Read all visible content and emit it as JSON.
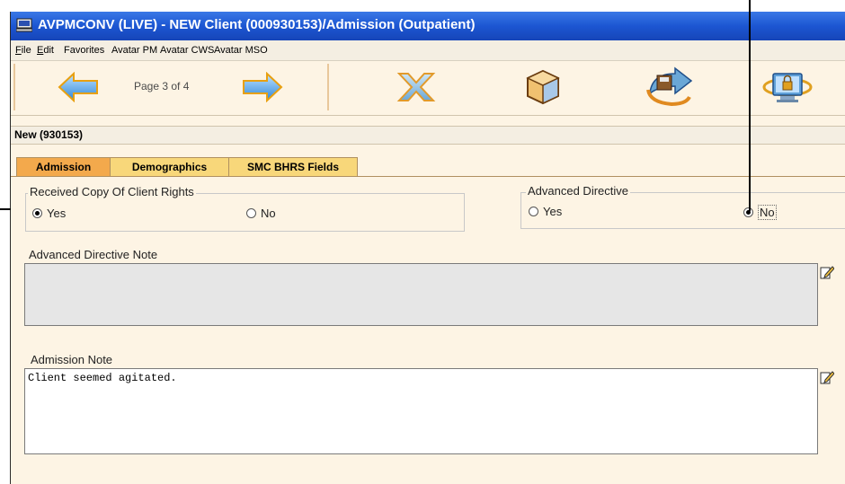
{
  "window": {
    "title": "AVPMCONV (LIVE) - NEW Client (000930153)/Admission (Outpatient)"
  },
  "menu": {
    "items": [
      {
        "mnemonic": "F",
        "rest": "ile"
      },
      {
        "mnemonic": "E",
        "rest": "dit"
      },
      {
        "mnemonic": "",
        "rest": "Favorites"
      },
      {
        "mnemonic": "",
        "rest": "Avatar PM"
      },
      {
        "mnemonic": "",
        "rest": "Avatar CWS"
      },
      {
        "mnemonic": "",
        "rest": "Avatar MSO"
      }
    ]
  },
  "toolbar": {
    "page_label": "Page 3 of 4",
    "icons": [
      "back-arrow-icon",
      "forward-arrow-icon",
      "discard-x-icon",
      "box-icon",
      "submit-disk-icon",
      "secure-monitor-icon"
    ]
  },
  "status": {
    "record": "New (930153)"
  },
  "tabs": [
    {
      "label": "Admission",
      "active": true
    },
    {
      "label": "Demographics",
      "active": false
    },
    {
      "label": "SMC BHRS Fields",
      "active": false
    }
  ],
  "form": {
    "client_rights": {
      "label": "Received Copy Of Client Rights",
      "options": [
        "Yes",
        "No"
      ],
      "selected": "Yes"
    },
    "advanced_directive": {
      "label": "Advanced Directive",
      "options": [
        "Yes",
        "No"
      ],
      "selected": "No"
    },
    "advanced_directive_note": {
      "label": "Advanced Directive Note",
      "value": ""
    },
    "admission_note": {
      "label": "Admission Note",
      "value": "Client seemed agitated."
    }
  },
  "colors": {
    "titlebar": "#1c56d2",
    "background": "#fdf4e4",
    "tab_active": "#f3a94c",
    "tab_inactive": "#f8d77a",
    "disabled_field": "#e6e6e6"
  }
}
